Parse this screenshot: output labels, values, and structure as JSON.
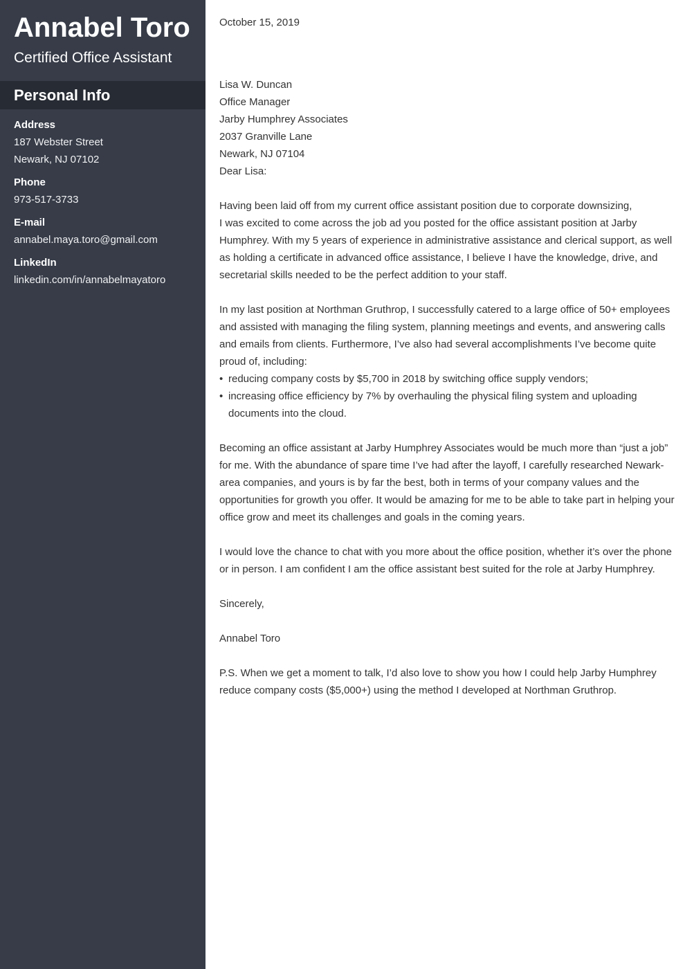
{
  "sidebar": {
    "name": "Annabel Toro",
    "title": "Certified Office Assistant",
    "section_title": "Personal Info",
    "info": [
      {
        "label": "Address",
        "values": [
          "187 Webster Street",
          "Newark, NJ 07102"
        ]
      },
      {
        "label": "Phone",
        "values": [
          "973-517-3733"
        ]
      },
      {
        "label": "E-mail",
        "values": [
          "annabel.maya.toro@gmail.com"
        ]
      },
      {
        "label": "LinkedIn",
        "values": [
          "linkedin.com/in/annabelmayatoro"
        ]
      }
    ]
  },
  "letter": {
    "date": "October 15, 2019",
    "recipient": [
      "Lisa W. Duncan",
      "Office Manager",
      "Jarby Humphrey Associates",
      "2037 Granville Lane",
      "Newark, NJ 07104"
    ],
    "greeting": "Dear Lisa:",
    "paragraphs": [
      "Having been laid off from my current office assistant position due to corporate downsizing,",
      "I was excited to come across the job ad you posted for the office assistant position at Jarby Humphrey. With my 5 years of experience in administrative assistance and clerical support, as well as holding a certificate in advanced office assistance, I believe I have the knowledge, drive, and secretarial skills needed to be the perfect addition to your staff.",
      "In my last position at Northman Gruthrop, I successfully catered to a large office of 50+ employees and assisted with managing the filing system, planning meetings and events, and answering calls and emails from clients. Furthermore, I’ve also had several accomplishments I’ve become quite proud of, including:",
      "Becoming an office assistant at Jarby Humphrey Associates would be much more than “just a job” for me. With the abundance of spare time I’ve had after the layoff, I carefully researched Newark-area companies, and yours is by far the best, both in terms of your company values and the opportunities for growth you offer. It would be amazing for me to be able to take part in helping your office grow and meet its challenges and goals in the coming years.",
      "I would love the chance to chat with you more about the office position, whether it’s over the phone or in person. I am confident I am the office assistant best suited for the role at Jarby Humphrey."
    ],
    "bullet_symbol": "•",
    "bullets": [
      "reducing company costs by $5,700 in 2018 by switching office supply vendors;",
      "increasing office efficiency by 7% by overhauling the physical filing system and uploading documents into the cloud."
    ],
    "closing": "Sincerely,",
    "signature": "Annabel Toro",
    "postscript": "P.S. When we get a moment to talk, I’d also love to show you how I could help Jarby Humphrey reduce company costs ($5,000+) using the method I developed at Northman Gruthrop."
  }
}
